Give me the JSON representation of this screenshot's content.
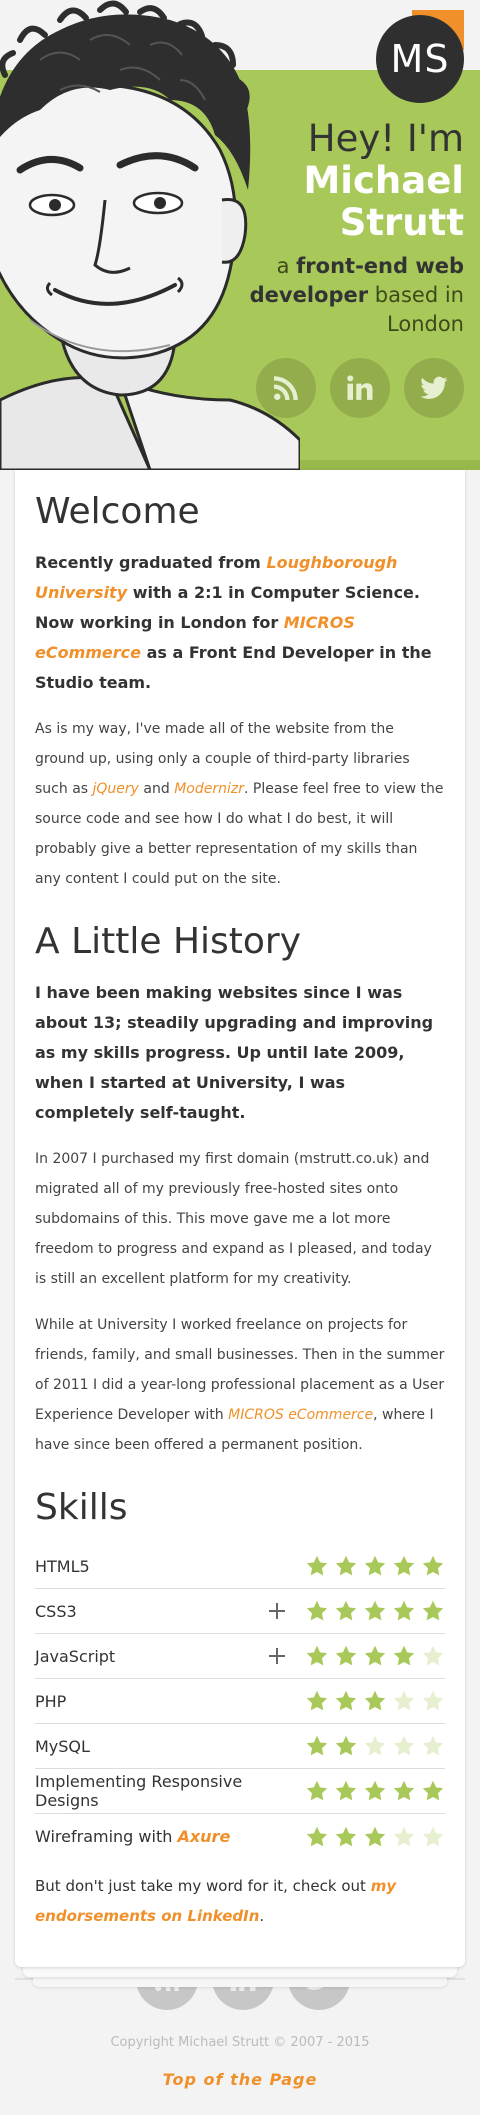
{
  "header": {
    "monogram": "MS",
    "greeting": "Hey! I'm",
    "name_line1": "Michael",
    "name_line2": "Strutt",
    "tagline_pre": "a",
    "tagline_bold": "front-end web developer",
    "tagline_post": "based in London",
    "social": [
      {
        "label": "RSS",
        "icon": "rss-icon"
      },
      {
        "label": "LinkedIn",
        "icon": "linkedin-icon"
      },
      {
        "label": "Twitter",
        "icon": "twitter-icon"
      }
    ]
  },
  "welcome": {
    "title": "Welcome",
    "lead_1": "Recently graduated from",
    "lead_link_1": "Loughborough University",
    "lead_2": "with a 2:1 in Computer Science. Now working in London for",
    "lead_link_2": "MICROS eCommerce",
    "lead_3": "as a Front End Developer in the Studio team.",
    "para_1": "As is my way, I've made all of the website from the ground up, using only a couple of third-party libraries such as",
    "para_link_1": "jQuery",
    "para_and": "and",
    "para_link_2": "Modernizr",
    "para_2": ". Please feel free to view the source code and see how I do what I do best, it will probably give a better representation of my skills than any content I could put on the site."
  },
  "history": {
    "title": "A Little History",
    "lead": "I have been making websites since I was about 13; steadily upgrading and improving as my skills progress. Up until late 2009, when I started at University, I was completely self-taught.",
    "para_1": "In 2007 I purchased my first domain (mstrutt.co.uk) and migrated all of my previously free-hosted sites onto subdomains of this. This move gave me a lot more freedom to progress and expand as I pleased, and today is still an excellent platform for my creativity.",
    "para_2a": "While at University I worked freelance on projects for friends, family, and small businesses. Then in the summer of 2011 I did a year-long professional placement as a User Experience Developer with",
    "para_2_link": "MICROS eCommerce",
    "para_2b": ", where I have since been offered a permanent position."
  },
  "skills": {
    "title": "Skills",
    "items": [
      {
        "name": "HTML5",
        "rating": 5,
        "expandable": false
      },
      {
        "name": "CSS3",
        "rating": 5,
        "expandable": true
      },
      {
        "name": "JavaScript",
        "rating": 4,
        "expandable": true
      },
      {
        "name": "PHP",
        "rating": 3,
        "expandable": false
      },
      {
        "name": "MySQL",
        "rating": 2,
        "expandable": false
      },
      {
        "name": "Implementing Responsive Designs",
        "rating": 5,
        "expandable": false
      },
      {
        "name": "Wireframing with",
        "link": "Axure",
        "rating": 3,
        "expandable": false
      }
    ],
    "outro_pre": "But don't just take my word for it, check out",
    "outro_link": "my endorsements on LinkedIn",
    "outro_post": "."
  },
  "footer": {
    "copyright": "Copyright Michael Strutt © 2007 - 2015",
    "top_link": "Top of the Page"
  },
  "colors": {
    "accent": "#f0902a",
    "green": "#a8c95a",
    "star_filled": "#a8c95a",
    "star_empty": "#e6efcf"
  }
}
